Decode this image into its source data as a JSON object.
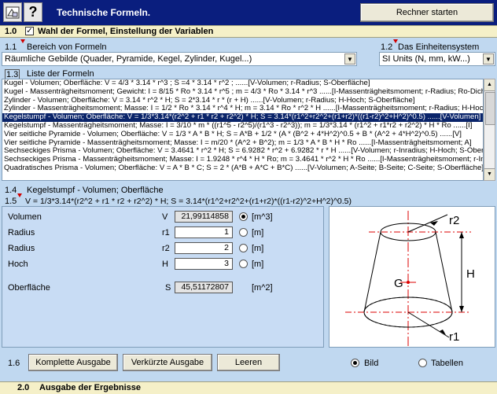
{
  "title": "Technische Formeln.",
  "rechner_button": "Rechner starten",
  "section1": {
    "num": "1.0",
    "label": "Wahl der Formel, Einstellung der Variablen"
  },
  "s11": {
    "num": "1.1",
    "label": "Bereich von Formeln",
    "value": "Räumliche Gebilde (Quader, Pyramide, Kegel, Zylinder, Kugel...)"
  },
  "s12": {
    "num": "1.2",
    "label": "Das Einheitensystem",
    "value": "SI Units (N, mm, kW...)"
  },
  "s13": {
    "num": "1.3",
    "label": "Liste der Formeln"
  },
  "list": [
    "Kugel - Volumen; Oberfläche: V = 4/3 * 3.14 * r^3 ; S =4 * 3.14 * r^2 ;       ......[V-Volumen; r-Radius; S-Oberfläche]",
    "Kugel - Massenträgheitsmoment; Gewicht: I = 8/15 * Ro * 3.14 * r^5 ; m = 4/3 * Ro * 3.14 * r^3    ......[I-Massenträgheitsmoment; r-Radius; Ro-Dichte]",
    "Zylinder - Volumen; Oberfläche: V = 3.14 * r^2 * H;  S = 2*3.14 * r * (r + H)   ......[V-Volumen; r-Radius; H-Hoch; S-Oberfläche]",
    "Zylinder - Massenträgheitsmoment; Masse: I = 1/2 * Ro * 3.14 * r^4 * H; m = 3.14 * Ro * r^2 * H    ......[I-Massenträgheitsmoment; r-Radius; H-Hoch]",
    "Kegelstumpf - Volumen; Oberfläche: V = 1/3*3.14*(r2^2 + r1 * r2 + r2^2) * H; S = 3.14*(r1^2+r2^2+(r1+r2)*((r1-r2)^2+H^2)^0.5)     ......[V-Volumen]",
    "Kegelstumpf - Massenträgheitsmoment; Masse: I = 3/10 * m * ((r1^5 - r2^5)/(r1^3 - r2^3)); m = 1/3*3.14 * (r1^2 + r1*r2 + r2^2) * H * Ro   ......[I]",
    "Vier seitliche Pyramide - Volumen; Oberfläche: V = 1/3 * A * B * H; S = A*B + 1/2 * (A * (B^2 + 4*H^2)^0.5 + B * (A^2 + 4*H^2)^0.5)  ......[V]",
    "Vier seitliche Pyramide - Massenträgheitsmoment; Masse: I = m/20 * (A^2 + B^2); m = 1/3 * A * B * H * Ro   ......[I-Massenträgheitsmoment; A]",
    "Sechseckiges Prisma - Volumen; Oberfläche: V = 3.4641 * r^2 * H; S = 6.9282 * r^2 + 6.9282 * r * H     ......[V-Volumen; r-Inradius; H-Hoch; S-Oberfläche]",
    "Sechseckiges Prisma - Massenträgheitsmoment; Masse: I = 1.9248 * r^4 * H * Ro; m = 3.4641 * r^2 * H * Ro   ......[I-Massenträgheitsmoment; r-Inradius]",
    "Quadratisches Prisma - Volumen; Oberfläche: V = A * B * C; S = 2 * (A*B + A*C + B*C)    ......[V-Volumen; A-Seite; B-Seite; C-Seite; S-Oberfläche]"
  ],
  "selected_index": 4,
  "s14": {
    "num": "1.4",
    "label": "Kegelstumpf - Volumen; Oberfläche"
  },
  "s15": {
    "num": "1.5",
    "formula": "V = 1/3*3.14*(r2^2 + r1 * r2 + r2^2) * H; S = 3.14*(r1^2+r2^2+(r1+r2)*((r1-r2)^2+H^2)^0.5)"
  },
  "vars": [
    {
      "name": "Volumen",
      "sym": "V",
      "value": "21,99114858",
      "unit": "[m^3]",
      "selected": true,
      "readonly": true
    },
    {
      "name": "Radius",
      "sym": "r1",
      "value": "1",
      "unit": "[m]",
      "selected": false,
      "readonly": false
    },
    {
      "name": "Radius",
      "sym": "r2",
      "value": "2",
      "unit": "[m]",
      "selected": false,
      "readonly": false
    },
    {
      "name": "Hoch",
      "sym": "H",
      "value": "3",
      "unit": "[m]",
      "selected": false,
      "readonly": false
    }
  ],
  "surface": {
    "name": "Oberfläche",
    "sym": "S",
    "value": "45,51172807",
    "unit": "[m^2]"
  },
  "diagram_labels": {
    "r2": "r2",
    "r1": "r1",
    "H": "H",
    "G": "G"
  },
  "s16": {
    "num": "1.6"
  },
  "buttons": {
    "komplett": "Komplette Ausgabe",
    "verkuerzt": "Verkürzte Ausgabe",
    "leeren": "Leeren"
  },
  "view": {
    "bild": "Bild",
    "tabellen": "Tabellen",
    "selected": "bild"
  },
  "section2": {
    "num": "2.0",
    "label": "Ausgabe der Ergebnisse"
  }
}
